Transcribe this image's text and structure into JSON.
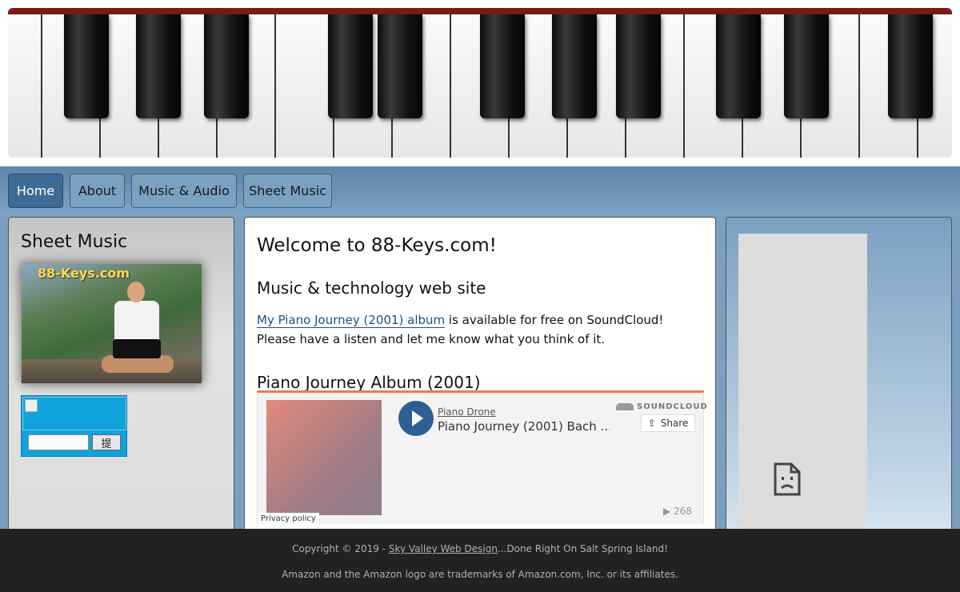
{
  "nav": {
    "items": [
      {
        "label": "Home",
        "active": true
      },
      {
        "label": "About",
        "active": false
      },
      {
        "label": "Music & Audio",
        "active": false
      },
      {
        "label": "Sheet Music",
        "active": false
      }
    ]
  },
  "sidebar": {
    "heading": "Sheet Music",
    "photo_caption": "88-Keys.com",
    "amazon_widget": {
      "search_value": "",
      "go_label": "提"
    }
  },
  "main": {
    "title": "Welcome to 88-Keys.com!",
    "subtitle": "Music & technology web site",
    "intro_link": "My Piano Journey (2001) album",
    "intro_rest": " is available for free on SoundCloud! Please have a listen and let me know what you think of it.",
    "section_title": "Piano Journey Album (2001)",
    "soundcloud": {
      "artist": "Piano Drone",
      "track": "Piano Journey (2001) Bach ...",
      "brand": "SOUNDCLOUD",
      "share_label": "Share",
      "play_count": "▶ 268",
      "privacy_label": "Privacy policy",
      "accent_color": "#f07b4a",
      "play_button_color": "#2d5f94"
    }
  },
  "footer": {
    "copyright_prefix": "Copyright © 2019 - ",
    "designer_link": "Sky Valley Web Design",
    "copyright_suffix": "...Done Right On Salt Spring Island!",
    "trademark_note": "Amazon and the Amazon logo are trademarks of Amazon.com, Inc. or its affiliates."
  },
  "colors": {
    "nav_background": "#7ba2c3",
    "nav_active": "#3e6b93",
    "footer_background": "#222222"
  }
}
